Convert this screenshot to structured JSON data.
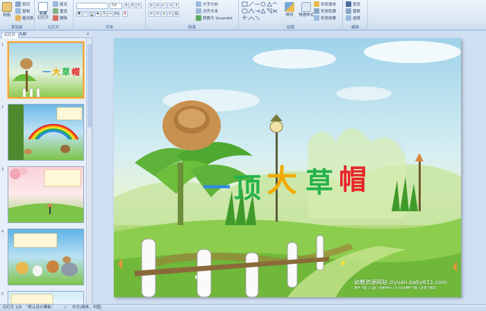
{
  "ribbon": {
    "clipboard": {
      "label": "剪贴板",
      "paste": "粘贴",
      "cut": "剪切",
      "copy": "复制",
      "format_painter": "格式刷"
    },
    "slides": {
      "label": "幻灯片",
      "new_slide": "新建\n幻灯片",
      "layout": "版式",
      "reset": "重设",
      "delete": "删除"
    },
    "font": {
      "label": "字体",
      "font_size": "54"
    },
    "paragraph": {
      "label": "段落",
      "text_direction": "文字方向",
      "align_text": "对齐文本",
      "smartart": "转换为 SmartArt"
    },
    "drawing": {
      "label": "绘图",
      "arrange": "排列",
      "quick_styles": "快速样式",
      "shape_fill": "形状填充",
      "shape_outline": "形状轮廓",
      "shape_effects": "形状效果"
    },
    "editing": {
      "label": "编辑",
      "find": "查找",
      "replace": "替换",
      "select": "选择"
    }
  },
  "pane": {
    "tab_slides": "幻灯片",
    "tab_outline": "大纲",
    "thumb_numbers": [
      "1",
      "2",
      "3",
      "4",
      "5"
    ]
  },
  "slide": {
    "title_chars": [
      "一",
      "顶",
      "大",
      "草",
      "帽"
    ],
    "title_colors": [
      "#2f8be0",
      "#25b24a",
      "#f2a900",
      "#25b24a",
      "#e8262a"
    ],
    "watermark_main": "幼教资源网站  ziyuan.baby611.com",
    "watermark_sub": "课件下载 | 儿歌 | 故事MP3 | FLASH课件下载 | 试卷下载等"
  },
  "status": {
    "slide_info": "幻灯片 1/8",
    "theme": "\"默认设计模板\"",
    "language": "中文(简体，中国)"
  }
}
